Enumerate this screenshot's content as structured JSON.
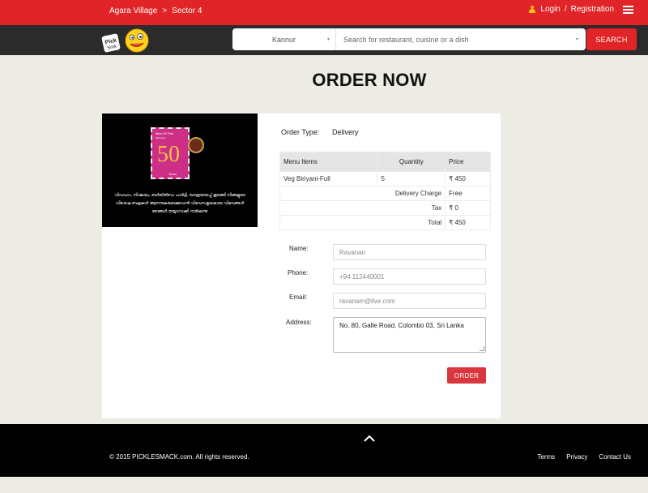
{
  "topbar": {
    "breadcrumbs": [
      "Agara Village",
      "Sector 4"
    ],
    "breadcrumb_sep": ">",
    "login": "Login",
    "auth_sep": "/",
    "registration": "Registration",
    "icons": [
      "user-icon",
      "hamburger-menu-icon"
    ]
  },
  "navbar": {
    "logo_icon": "picklesmack-logo",
    "location_value": "Kannur",
    "search_placeholder": "Search for restaurant, cuisine or a dish",
    "dropdown_caret": "▾",
    "search_button": "SEARCH"
  },
  "page": {
    "title": "ORDER NOW"
  },
  "promo": {
    "stamp_line1": "Best Of First",
    "stamp_line2": "Moments",
    "stamp_number": "50",
    "stamp_years": "Years",
    "text": "വിവാഹം, നിശ്ചയം, ബർത്ത്ഡേ പാർട്ടി, യാത്രയയപ്പ് തുടങ്ങി നിങ്ങളുടെ വിശേഷ വേളകൾ ആനന്ദകരമാക്കുവാൻ വിഭവസമൃദ്ധമായ വിഭവങ്ങൾ ഞങ്ങൾ തയ്യാറാക്കി നൽകുന്നു"
  },
  "order": {
    "type_label": "Order Type:",
    "type_value": "Delivery",
    "table": {
      "headers": [
        "Menu Items",
        "Quantity",
        "Price"
      ],
      "rows": [
        {
          "item": "Veg Biriyani-Full",
          "qty": "5",
          "price": "₹ 450"
        }
      ],
      "delivery_label": "Delivery Charge",
      "delivery_value": "Free",
      "tax_label": "Tax",
      "tax_value": "₹ 0",
      "total_label": "Total",
      "total_value": "₹ 450"
    }
  },
  "form": {
    "name_label": "Name:",
    "name_value": "Ravanan",
    "phone_label": "Phone:",
    "phone_value": "+94 112440001",
    "email_label": "Email:",
    "email_value": "ravanam@live.com",
    "address_label": "Address:",
    "address_value": "No. 80, Galle Road, Colombo 03, Sri Lanka",
    "submit": "ORDER"
  },
  "footer": {
    "scroll_top_icon": "chevron-up-icon",
    "copyright": "© 2015 PICKLESMACK.com. All rights reserved.",
    "links": [
      "Terms",
      "Privacy",
      "Contact Us"
    ]
  },
  "colors": {
    "brand_red": "#e02428",
    "nav_dark": "#2b2b2b",
    "page_bg": "#ecebe4",
    "footer_bg": "#000000"
  }
}
